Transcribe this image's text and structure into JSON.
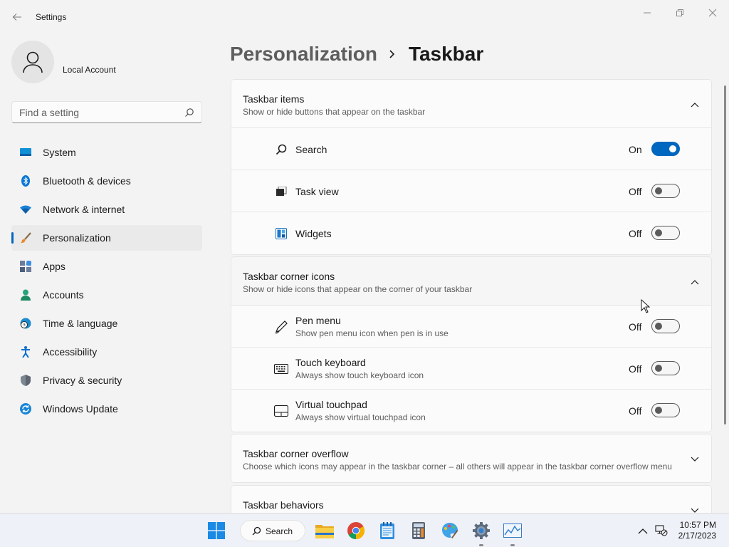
{
  "window": {
    "title": "Settings"
  },
  "profile": {
    "name": "Local Account"
  },
  "search": {
    "placeholder": "Find a setting"
  },
  "sidebar": {
    "items": [
      {
        "label": "System",
        "icon": "monitor-icon"
      },
      {
        "label": "Bluetooth & devices",
        "icon": "bluetooth-icon"
      },
      {
        "label": "Network & internet",
        "icon": "wifi-icon"
      },
      {
        "label": "Personalization",
        "icon": "brush-icon",
        "active": true
      },
      {
        "label": "Apps",
        "icon": "apps-icon"
      },
      {
        "label": "Accounts",
        "icon": "person-icon"
      },
      {
        "label": "Time & language",
        "icon": "globe-clock-icon"
      },
      {
        "label": "Accessibility",
        "icon": "accessibility-icon"
      },
      {
        "label": "Privacy & security",
        "icon": "shield-icon"
      },
      {
        "label": "Windows Update",
        "icon": "update-icon"
      }
    ]
  },
  "breadcrumb": {
    "parent": "Personalization",
    "current": "Taskbar"
  },
  "sections": {
    "taskbar_items": {
      "title": "Taskbar items",
      "subtitle": "Show or hide buttons that appear on the taskbar",
      "expanded": true,
      "rows": [
        {
          "label": "Search",
          "state": "On",
          "on": true,
          "icon": "search-icon"
        },
        {
          "label": "Task view",
          "state": "Off",
          "on": false,
          "icon": "task-view-icon"
        },
        {
          "label": "Widgets",
          "state": "Off",
          "on": false,
          "icon": "widgets-icon"
        }
      ]
    },
    "corner_icons": {
      "title": "Taskbar corner icons",
      "subtitle": "Show or hide icons that appear on the corner of your taskbar",
      "expanded": true,
      "rows": [
        {
          "label": "Pen menu",
          "desc": "Show pen menu icon when pen is in use",
          "state": "Off",
          "on": false,
          "icon": "pen-icon"
        },
        {
          "label": "Touch keyboard",
          "desc": "Always show touch keyboard icon",
          "state": "Off",
          "on": false,
          "icon": "keyboard-icon"
        },
        {
          "label": "Virtual touchpad",
          "desc": "Always show virtual touchpad icon",
          "state": "Off",
          "on": false,
          "icon": "touchpad-icon"
        }
      ]
    },
    "corner_overflow": {
      "title": "Taskbar corner overflow",
      "subtitle": "Choose which icons may appear in the taskbar corner – all others will appear in the taskbar corner overflow menu",
      "expanded": false
    },
    "behaviors": {
      "title": "Taskbar behaviors",
      "expanded": false
    }
  },
  "taskbar": {
    "search_label": "Search",
    "apps": [
      "file-explorer-icon",
      "chrome-icon",
      "notepad-icon",
      "calculator-icon",
      "paint-icon",
      "settings-icon",
      "task-manager-icon"
    ],
    "time": "10:57 PM",
    "date": "2/17/2023"
  },
  "colors": {
    "accent": "#0067c0",
    "background": "#f3f3f3",
    "card": "#fbfbfb"
  }
}
